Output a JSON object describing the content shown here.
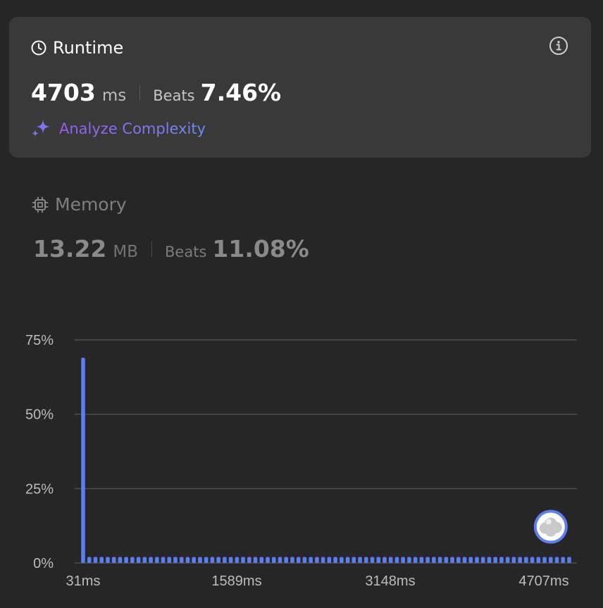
{
  "runtime": {
    "title": "Runtime",
    "value": "4703",
    "unit": "ms",
    "beats_label": "Beats",
    "beats_value": "7.46%",
    "analyze_label": "Analyze Complexity",
    "icons": [
      "clock-icon",
      "info-icon",
      "sparkle-icon"
    ]
  },
  "memory": {
    "title": "Memory",
    "value": "13.22",
    "unit": "MB",
    "beats_label": "Beats",
    "beats_value": "11.08%",
    "icons": [
      "cpu-chip-icon"
    ]
  },
  "colors": {
    "background": "#262626",
    "card": "#393939",
    "bar": "#5b7ff0",
    "grid": "#4e4e4e",
    "accent_gradient": [
      "#9a5cf0",
      "#6a8cf5"
    ]
  },
  "chart_data": {
    "type": "bar",
    "x_tick_labels": [
      "31ms",
      "1589ms",
      "3148ms",
      "4707ms"
    ],
    "y_tick_labels": [
      "75%",
      "50%",
      "25%",
      "0%"
    ],
    "ylim": [
      0,
      75
    ],
    "grid": true,
    "first_bar_value": 69,
    "other_bars_value": 2,
    "num_bars": 80,
    "user_marker": {
      "label": "your runtime (avatar)",
      "bar_index": 76
    }
  }
}
